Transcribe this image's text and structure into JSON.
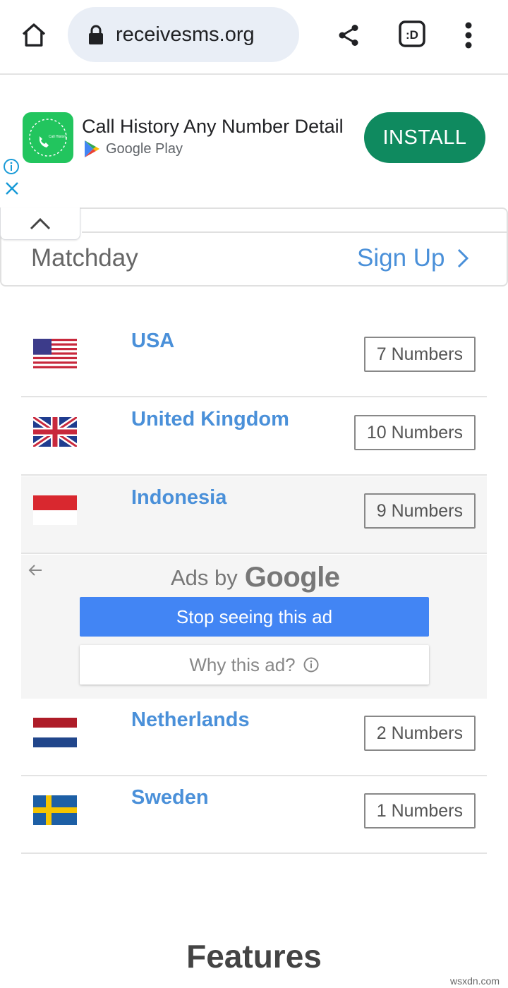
{
  "browser": {
    "url": "receivesms.org"
  },
  "ad_banner": {
    "title": "Call History Any Number Detail",
    "store": "Google Play",
    "install_label": "INSTALL",
    "app_icon_text": "Call History"
  },
  "header": {
    "matchday": "Matchday",
    "signup": "Sign Up"
  },
  "countries": [
    {
      "name": "USA",
      "count": "7 Numbers"
    },
    {
      "name": "United Kingdom",
      "count": "10 Numbers"
    },
    {
      "name": "Indonesia",
      "count": "9 Numbers"
    },
    {
      "name": "Netherlands",
      "count": "2 Numbers"
    },
    {
      "name": "Sweden",
      "count": "1 Numbers"
    }
  ],
  "ad_feedback": {
    "ads_by": "Ads by",
    "google": "Google",
    "stop_label": "Stop seeing this ad",
    "why_label": "Why this ad?"
  },
  "section_title": "Features",
  "watermark": "wsxdn.com",
  "colors": {
    "link": "#4a90d9",
    "install": "#0f8a5f",
    "stop_button": "#4285f4"
  }
}
